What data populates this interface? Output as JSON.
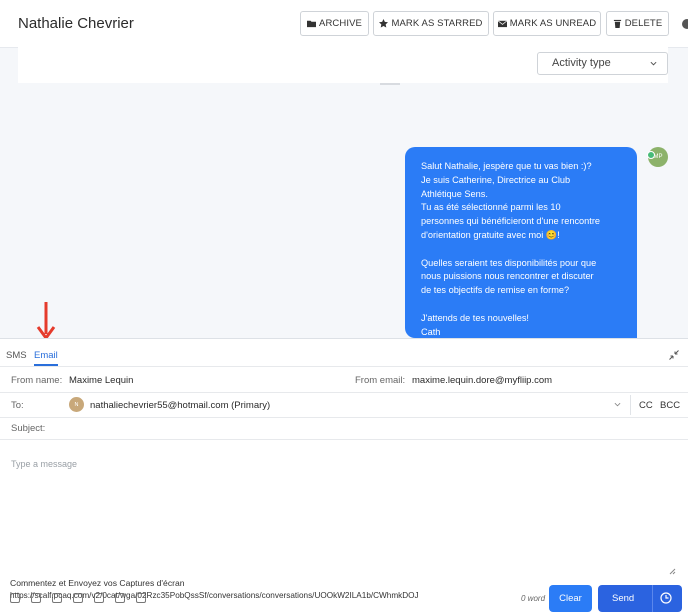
{
  "header": {
    "contact_name": "Nathalie Chevrier",
    "buttons": {
      "archive": "ARCHIVE",
      "starred": "MARK AS STARRED",
      "unread": "MARK AS UNREAD",
      "delete": "DELETE"
    },
    "icons": [
      "folder-icon",
      "star-icon",
      "envelope-icon",
      "trash-icon"
    ]
  },
  "filter": {
    "activity_type": "Activity type"
  },
  "message": {
    "sender_initials": "MP",
    "lines": [
      "Salut Nathalie, jespère que tu vas bien :)?",
      "Je suis Catherine, Directrice au Club",
      "Athlétique Sens.",
      "Tu as été sélectionné parmi les 10",
      "personnes qui bénéficieront d'une rencontre",
      "d'orientation gratuite avec moi 😊!",
      "",
      "Quelles seraient tes disponibilités pour que",
      "nous puissions nous rencontrer et discuter",
      "de tes objectifs de remise en forme?",
      "",
      "J'attends de tes nouvelles!",
      "Cath"
    ]
  },
  "composer": {
    "tabs": {
      "sms": "SMS",
      "email": "Email"
    },
    "from_name_label": "From name:",
    "from_name_value": "Maxime Lequin",
    "from_email_label": "From email:",
    "from_email_value": "maxime.lequin.dore@myfliip.com",
    "to_label": "To:",
    "to_initials": "N",
    "to_value": "nathaliechevrier55@hotmail.com (Primary)",
    "cc": "CC",
    "bcc": "BCC",
    "subject_label": "Subject:",
    "message_placeholder": "Type a message",
    "word_count": "0 word",
    "clear": "Clear",
    "send": "Send"
  },
  "overlay": {
    "caption": "Commentez et Envoyez vos Captures d'écran",
    "url": "https://scalf.pcaq.com/v2/0cat/wga/02Rzc35PobQssSf/conversations/conversations/UOOkW2ILA1b/CWhmkDOJ"
  },
  "colors": {
    "accent": "#2b7cf6",
    "send": "#2b63e0",
    "arrow": "#e53b2c"
  }
}
